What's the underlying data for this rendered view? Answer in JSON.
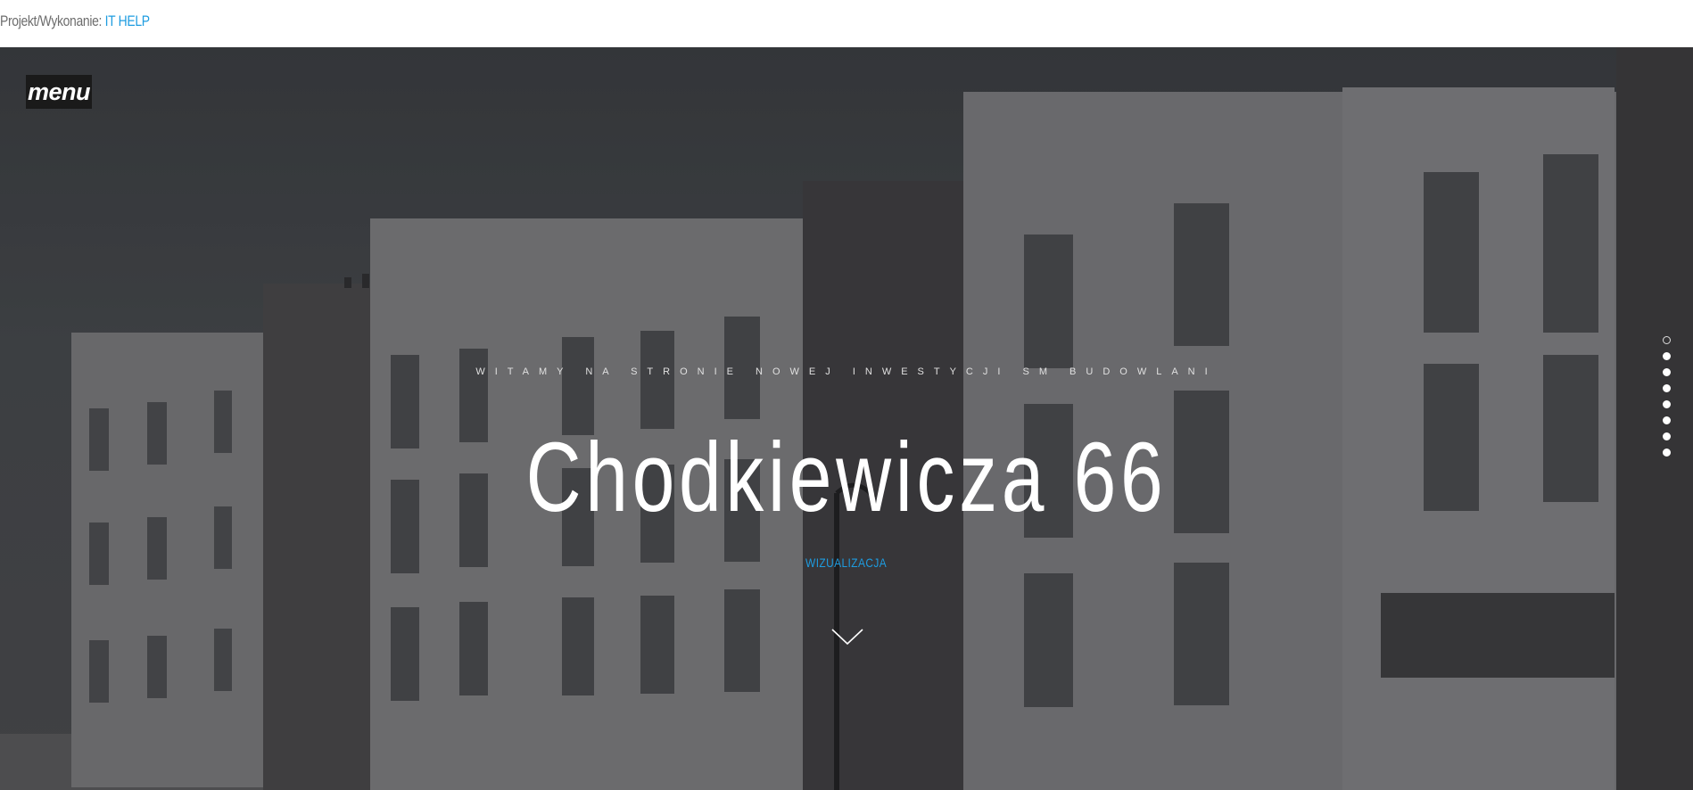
{
  "top_credit": {
    "label": "Projekt/Wykonanie:",
    "link_text": "IT HELP",
    "link_color": "#1e9ce0"
  },
  "hero": {
    "menu_label": "menu",
    "welcome_text": "WITAMY NA STRONIE NOWEJ INWESTYCJI SM BUDOWLANI",
    "title": "Chodkiewicza 66",
    "sub_link": "WIZUALIZACJA",
    "arrow_icon": "chevron-down-icon",
    "section_dots": {
      "count": 8,
      "active_index": 0
    }
  }
}
